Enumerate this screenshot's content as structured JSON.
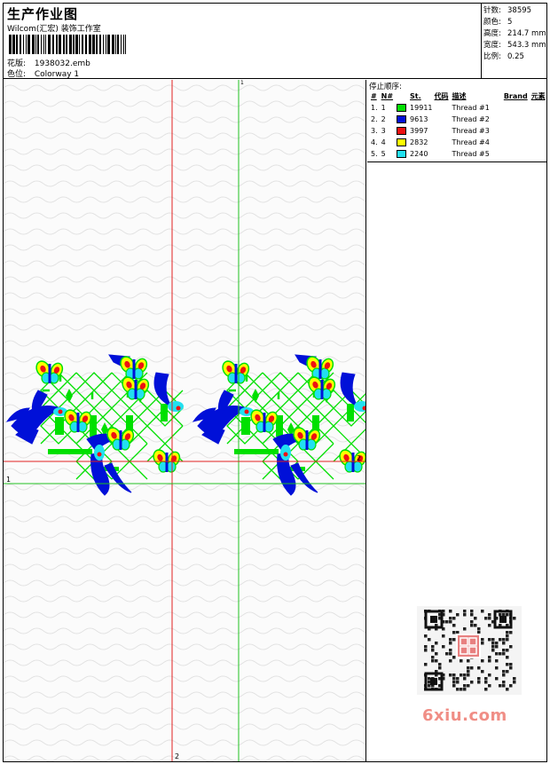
{
  "header": {
    "title": "生产作业图",
    "company": "Wilcom(汇宏) 装饰工作室",
    "pattern_label": "花版:",
    "pattern_value": "1938032.emb",
    "colorway_label": "色位:",
    "colorway_value": "Colorway 1"
  },
  "stats": [
    {
      "label": "针数:",
      "value": "38595"
    },
    {
      "label": "颜色:",
      "value": "5"
    },
    {
      "label": "高度:",
      "value": "214.7 mm"
    },
    {
      "label": "宽度:",
      "value": "543.3 mm"
    },
    {
      "label": "比例:",
      "value": "0.25"
    }
  ],
  "stop_sequence": {
    "title": "停止顺序:",
    "headers": [
      "#",
      "N#",
      "St.",
      "代码",
      "描述",
      "Brand",
      "元素"
    ],
    "rows": [
      {
        "index": "1.",
        "n": "1",
        "color": "#00e000",
        "stitches": "19911",
        "desc": "Thread #1"
      },
      {
        "index": "2.",
        "n": "2",
        "color": "#0010d8",
        "stitches": "9613",
        "desc": "Thread #2"
      },
      {
        "index": "3.",
        "n": "3",
        "color": "#ee1111",
        "stitches": "3997",
        "desc": "Thread #3"
      },
      {
        "index": "4.",
        "n": "4",
        "color": "#ffff00",
        "stitches": "2832",
        "desc": "Thread #4"
      },
      {
        "index": "5.",
        "n": "5",
        "color": "#22e0f0",
        "stitches": "2240",
        "desc": "Thread #5"
      }
    ]
  },
  "axes": {
    "vertical_label": "2",
    "horizontal_label_left": "1",
    "horizontal_label_right": "2",
    "top_marker": "1"
  },
  "watermark": "6xiu.com",
  "colors": {
    "green": "#00e000",
    "blue": "#0010d8",
    "red": "#ee1111",
    "yellow": "#ffff00",
    "cyan": "#22e0f0",
    "guide_red": "#e02020",
    "guide_green": "#20c020"
  }
}
